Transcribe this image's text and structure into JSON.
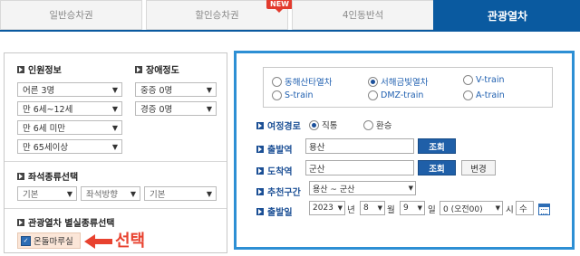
{
  "tabs": [
    {
      "label": "일반승차권"
    },
    {
      "label": "할인승차권",
      "badge": "NEW"
    },
    {
      "label": "4인동반석"
    },
    {
      "label": "관광열차"
    }
  ],
  "left": {
    "passenger_title": "인원정보",
    "disabled_title": "장애정도",
    "passenger_selects": [
      "어른 3명",
      "만 6세~12세",
      "만 6세 미만",
      "만 65세이상"
    ],
    "disabled_selects": [
      "중증 0명",
      "경증 0명"
    ],
    "seat_title": "좌석종류선택",
    "seat_selects": [
      "기본",
      "좌석방향",
      "기본"
    ],
    "tour_seat_title": "관광열차 별실종류선택",
    "tour_option": "온돌마루실",
    "annotation": "선택"
  },
  "right": {
    "trains": [
      "동해산타열차",
      "서해금빛열차",
      "V-train",
      "S-train",
      "DMZ-train",
      "A-train"
    ],
    "selected_train": "서해금빛열차",
    "route_label": "여정경로",
    "route_options": [
      "직통",
      "환승"
    ],
    "depart_label": "출발역",
    "depart_value": "용산",
    "arrive_label": "도착역",
    "arrive_value": "군산",
    "lookup_button": "조회",
    "change_button": "변경",
    "recommend_label": "추천구간",
    "recommend_value": "용산 ~ 군산",
    "date_label": "출발일",
    "year": "2023",
    "year_unit": "년",
    "month": "8",
    "month_unit": "월",
    "day": "9",
    "day_unit": "일",
    "hour": "0 (오전00)",
    "hour_unit": "시",
    "weekday": "수"
  },
  "colors": {
    "accent": "#0a5aa0",
    "panel_border": "#2d8fd4",
    "annotation": "#e8422f"
  }
}
